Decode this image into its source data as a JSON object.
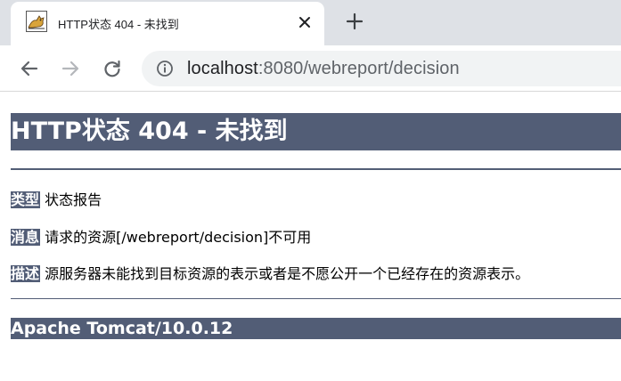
{
  "browser": {
    "tab": {
      "title": "HTTP状态 404 - 未找到",
      "favicon": "tomcat-icon"
    },
    "close_icon": "close-icon",
    "new_tab_icon": "plus-icon",
    "nav": {
      "back_icon": "back-arrow-icon",
      "forward_icon": "forward-arrow-icon",
      "reload_icon": "reload-icon"
    },
    "address": {
      "info_icon": "info-icon",
      "host": "localhost",
      "rest": ":8080/webreport/decision"
    }
  },
  "page": {
    "heading": "HTTP状态 404 - 未找到",
    "rows": [
      {
        "label": "类型",
        "text": "状态报告"
      },
      {
        "label": "消息",
        "text": "请求的资源[/webreport/decision]不可用"
      },
      {
        "label": "描述",
        "text": "源服务器未能找到目标资源的表示或者是不愿公开一个已经存在的资源表示。"
      }
    ],
    "footer": "Apache Tomcat/10.0.12"
  },
  "colors": {
    "header_bg": "#525d76",
    "tabstrip_bg": "#dee1e6",
    "omnibox_bg": "#f1f3f4"
  }
}
